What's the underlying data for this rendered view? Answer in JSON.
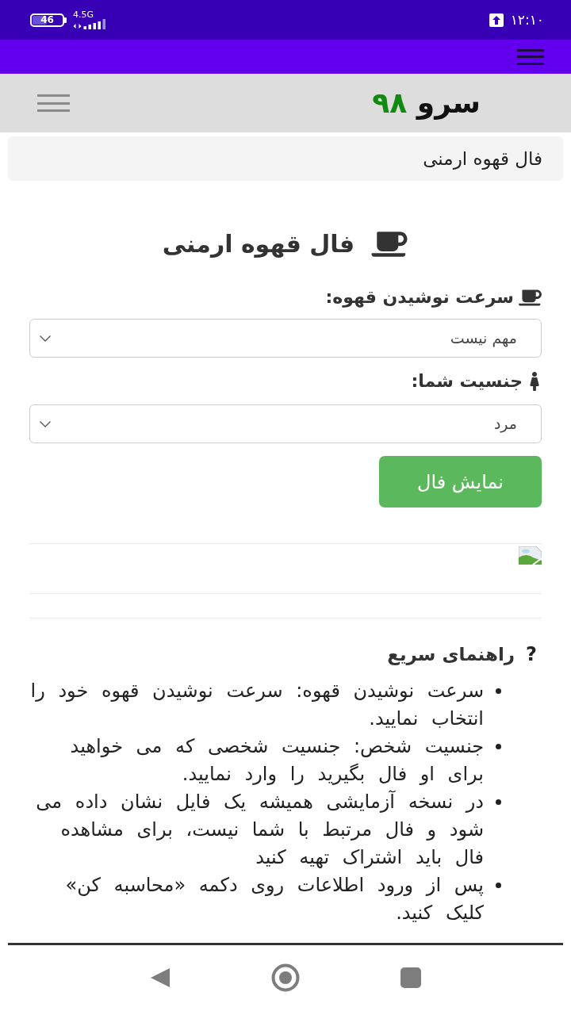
{
  "status_bar": {
    "battery": "46",
    "network": "4.5G",
    "time": "۱۲:۱۰"
  },
  "site_header": {
    "logo_word": "سرو",
    "logo_number": "۹۸"
  },
  "breadcrumb": "فال قهوه ارمنی",
  "page_title": "فال قهوه ارمنی",
  "form": {
    "fields": [
      {
        "kind": "coffee",
        "label": "سرعت نوشیدن قهوه:",
        "value": "مهم نیست"
      },
      {
        "kind": "gender",
        "label": "جنسیت شما:",
        "value": "مرد"
      }
    ],
    "submit_button": "نمایش فال"
  },
  "help": {
    "icon_glyph": "?",
    "title": "راهنمای سریع",
    "items": [
      "سرعت نوشیدن قهوه: سرعت نوشیدن قهوه خود را انتخاب نمایید.",
      "جنسیت شخص: جنسیت شخصی که می خواهید برای او فال بگیرید را وارد نمایید.",
      "در نسخه آزمایشی همیشه یک فایل نشان داده می شود و فال مرتبط با شما نیست، برای مشاهده فال باید اشتراک تهیه کنید",
      "پس از ورود اطلاعات روی دکمه «محاسبه کن» کلیک کنید."
    ]
  }
}
